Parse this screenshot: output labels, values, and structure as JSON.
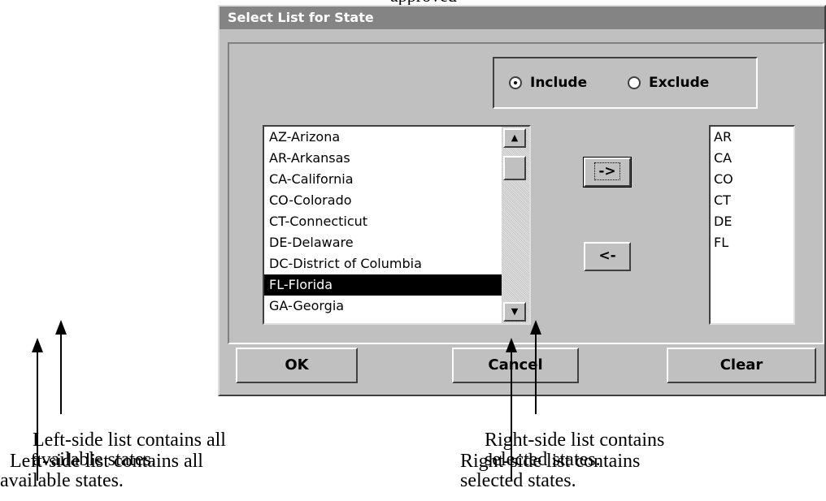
{
  "page_top_fragment": "approved",
  "window": {
    "title": "Select List for State"
  },
  "filter_mode": {
    "include_label": "Include",
    "exclude_label": "Exclude",
    "selected": "Include"
  },
  "available_list": {
    "items": [
      "AZ-Arizona",
      "AR-Arkansas",
      "CA-California",
      "CO-Colorado",
      "CT-Connecticut",
      "DE-Delaware",
      "DC-District of Columbia",
      "FL-Florida",
      "GA-Georgia"
    ],
    "selected_item": "FL-Florida"
  },
  "selected_list": {
    "items": [
      "AR",
      "CA",
      "CO",
      "CT",
      "DE",
      "FL"
    ]
  },
  "move_buttons": {
    "add_label": "->",
    "remove_label": "<-"
  },
  "dialog_buttons": {
    "ok_label": "OK",
    "cancel_label": "Cancel",
    "clear_label": "Clear"
  },
  "annotations": {
    "left_caption_line1": "Left-side list contains all",
    "left_caption_line2": "available states.",
    "right_caption_line1": "Right-side list contains",
    "right_caption_line2": "selected states."
  }
}
